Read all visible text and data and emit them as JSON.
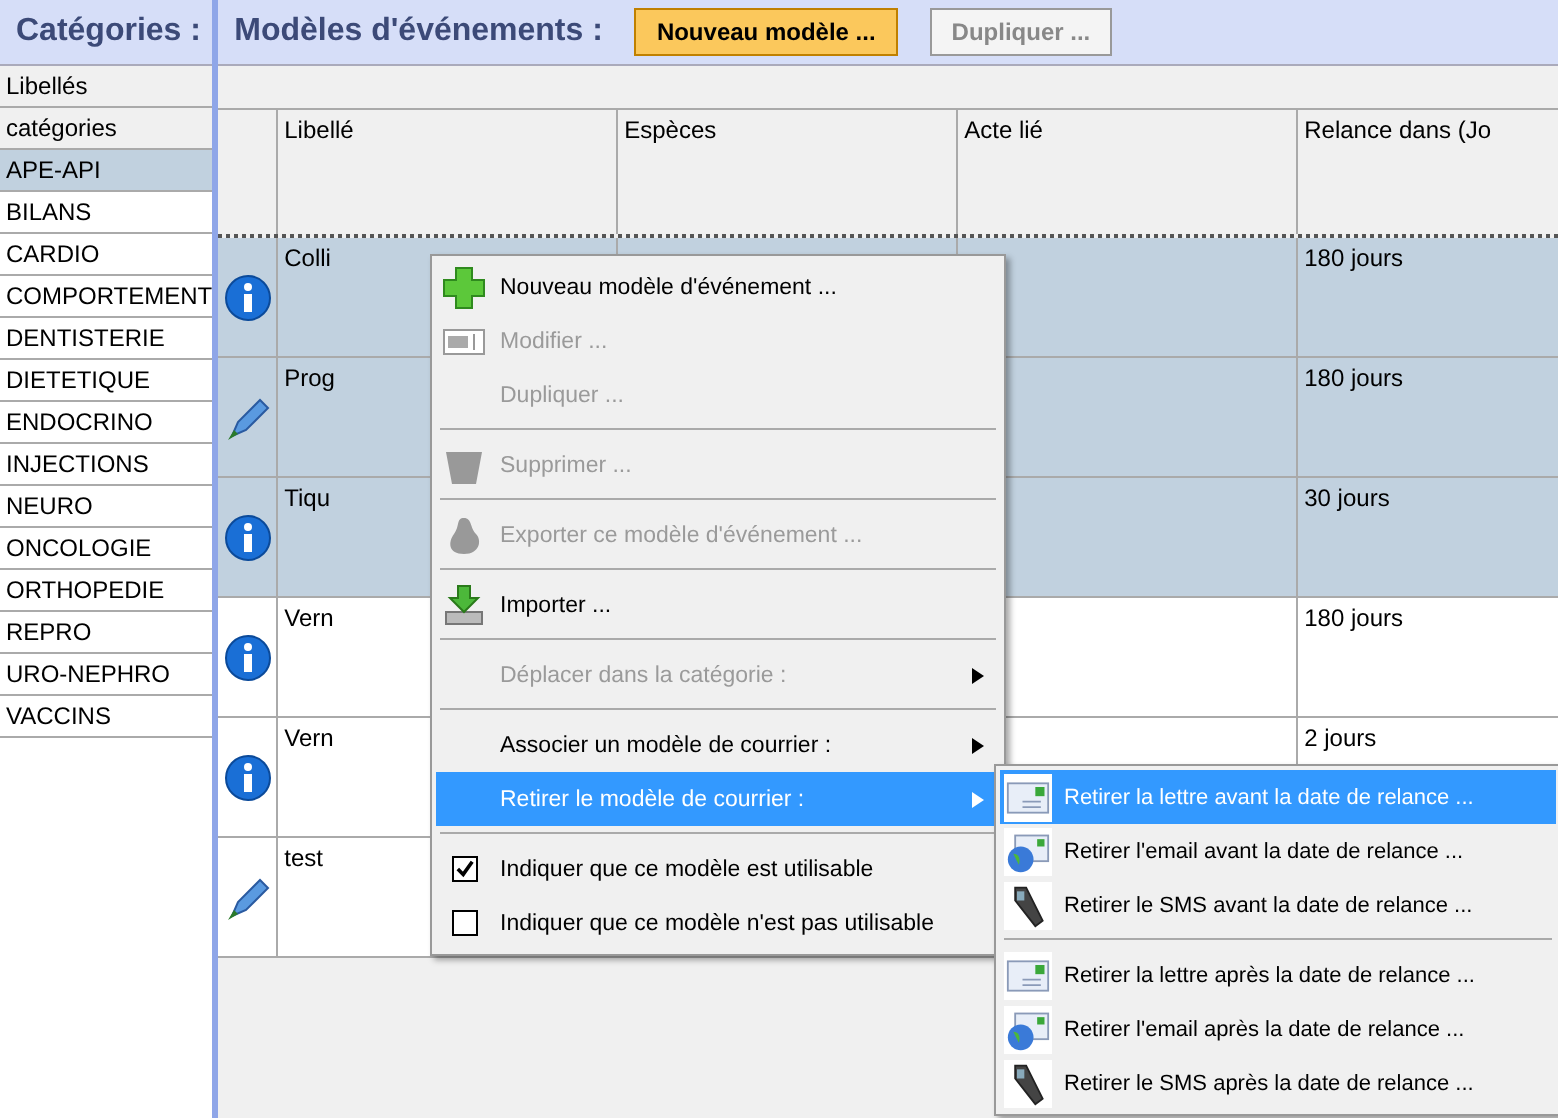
{
  "categories_panel": {
    "title": "Catégories :",
    "header_rows": [
      "Libellés",
      "catégories"
    ],
    "items": [
      {
        "label": "APE-API",
        "selected": true
      },
      {
        "label": "BILANS",
        "selected": false
      },
      {
        "label": "CARDIO",
        "selected": false
      },
      {
        "label": "COMPORTEMENT",
        "selected": false
      },
      {
        "label": "DENTISTERIE",
        "selected": false
      },
      {
        "label": "DIETETIQUE",
        "selected": false
      },
      {
        "label": "ENDOCRINO",
        "selected": false
      },
      {
        "label": "INJECTIONS",
        "selected": false
      },
      {
        "label": "NEURO",
        "selected": false
      },
      {
        "label": "ONCOLOGIE",
        "selected": false
      },
      {
        "label": "ORTHOPEDIE",
        "selected": false
      },
      {
        "label": "REPRO",
        "selected": false
      },
      {
        "label": "URO-NEPHRO",
        "selected": false
      },
      {
        "label": "VACCINS",
        "selected": false
      }
    ]
  },
  "models_panel": {
    "title": "Modèles d'événements :",
    "buttons": [
      {
        "label": "Nouveau modèle ...",
        "disabled": false
      },
      {
        "label": "Dupliquer ...",
        "disabled": true
      }
    ],
    "table": {
      "columns": [
        "Libellé",
        "Espèces",
        "Acte lié",
        "Relance dans (Jo"
      ],
      "rows": [
        {
          "kind": "info",
          "selected": true,
          "cells": [
            "Colli",
            "",
            "",
            "180 jours"
          ]
        },
        {
          "kind": "pen",
          "selected": true,
          "cells": [
            "Prog",
            "",
            "",
            "180 jours"
          ]
        },
        {
          "kind": "info",
          "selected": true,
          "cells": [
            "Tiqu",
            "",
            "",
            "30 jours"
          ]
        },
        {
          "kind": "info",
          "selected": false,
          "cells": [
            "Vern",
            "",
            "",
            "180 jours"
          ]
        },
        {
          "kind": "info",
          "selected": false,
          "cells": [
            "Vern",
            "",
            "",
            "2 jours"
          ]
        },
        {
          "kind": "pen",
          "selected": false,
          "cells": [
            "test",
            "",
            "",
            ""
          ]
        }
      ]
    }
  },
  "context_menu": {
    "items": [
      {
        "kind": "plus",
        "label": "Nouveau modèle d'événement ...",
        "disabled": false,
        "submenu": false,
        "selected": false
      },
      {
        "kind": "field",
        "label": "Modifier ...",
        "disabled": true,
        "submenu": false,
        "selected": false
      },
      {
        "kind": "plain",
        "label": "Dupliquer ...",
        "disabled": true,
        "submenu": false,
        "selected": false
      },
      {
        "kind": "separator"
      },
      {
        "kind": "bucket",
        "label": "Supprimer ...",
        "disabled": true,
        "submenu": false,
        "selected": false
      },
      {
        "kind": "separator"
      },
      {
        "kind": "blob",
        "label": "Exporter ce modèle d'événement ...",
        "disabled": true,
        "submenu": false,
        "selected": false
      },
      {
        "kind": "separator"
      },
      {
        "kind": "import",
        "label": "Importer ...",
        "disabled": false,
        "submenu": false,
        "selected": false
      },
      {
        "kind": "separator"
      },
      {
        "kind": "plain",
        "label": "Déplacer dans la catégorie :",
        "disabled": true,
        "submenu": true,
        "selected": false
      },
      {
        "kind": "separator"
      },
      {
        "kind": "plain",
        "label": "Associer un modèle de courrier :",
        "disabled": false,
        "submenu": true,
        "selected": false
      },
      {
        "kind": "plain",
        "label": "Retirer le modèle de courrier :",
        "disabled": false,
        "submenu": true,
        "selected": true
      },
      {
        "kind": "separator"
      },
      {
        "kind": "check",
        "label": "Indiquer que ce modèle est utilisable",
        "checked": true
      },
      {
        "kind": "check",
        "label": "Indiquer que ce modèle n'est pas utilisable",
        "checked": false
      }
    ]
  },
  "submenu": {
    "items": [
      {
        "kind": "letter",
        "label": "Retirer la lettre avant la date de relance ...",
        "selected": true
      },
      {
        "kind": "email",
        "label": "Retirer l'email avant la date de relance ...",
        "selected": false
      },
      {
        "kind": "phone",
        "label": "Retirer le SMS avant la date de relance ...",
        "selected": false
      },
      {
        "kind": "separator"
      },
      {
        "kind": "letter",
        "label": "Retirer la lettre après la date de relance ...",
        "selected": false
      },
      {
        "kind": "email",
        "label": "Retirer l'email après la date de relance ...",
        "selected": false
      },
      {
        "kind": "phone",
        "label": "Retirer le SMS après la date de relance ...",
        "selected": false
      }
    ]
  }
}
